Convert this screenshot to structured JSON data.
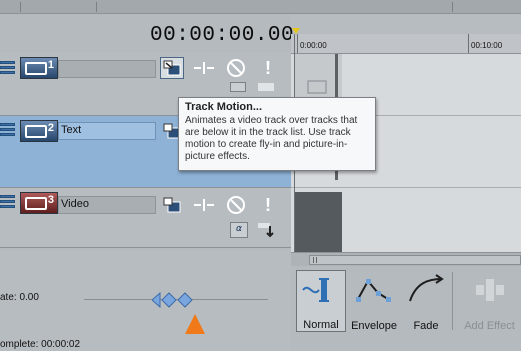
{
  "timecode": "00:00:00.00",
  "ruler": {
    "labels": [
      "0:00:00",
      "00:10:00"
    ]
  },
  "tracks": [
    {
      "number": "1",
      "name": "",
      "color": "blue"
    },
    {
      "number": "2",
      "name": "Text",
      "color": "blue"
    },
    {
      "number": "3",
      "name": "Video",
      "color": "red"
    }
  ],
  "tooltip": {
    "title": "Track Motion...",
    "body": "Animates a video track over tracks that are below it in the track list. Use track motion to create fly-in and picture-in-picture effects."
  },
  "transport": {
    "rate_label": "ate: 0.00",
    "complete_label": "omplete: 00:00:02"
  },
  "fx_buttons": [
    {
      "label": "Normal",
      "icon": "normal-fade-icon",
      "active": true
    },
    {
      "label": "Envelope",
      "icon": "envelope-icon",
      "active": false
    },
    {
      "label": "Fade",
      "icon": "fade-curve-icon",
      "active": false
    },
    {
      "label": "Add Effect",
      "icon": "add-effect-icon",
      "active": false,
      "disabled": true
    }
  ],
  "colors": {
    "selected_track": "#8eb2d6",
    "track_icon_blue": "#3d6fa6",
    "orange_marker": "#f07a1a",
    "arrow_blue": "#7aa6e0"
  }
}
